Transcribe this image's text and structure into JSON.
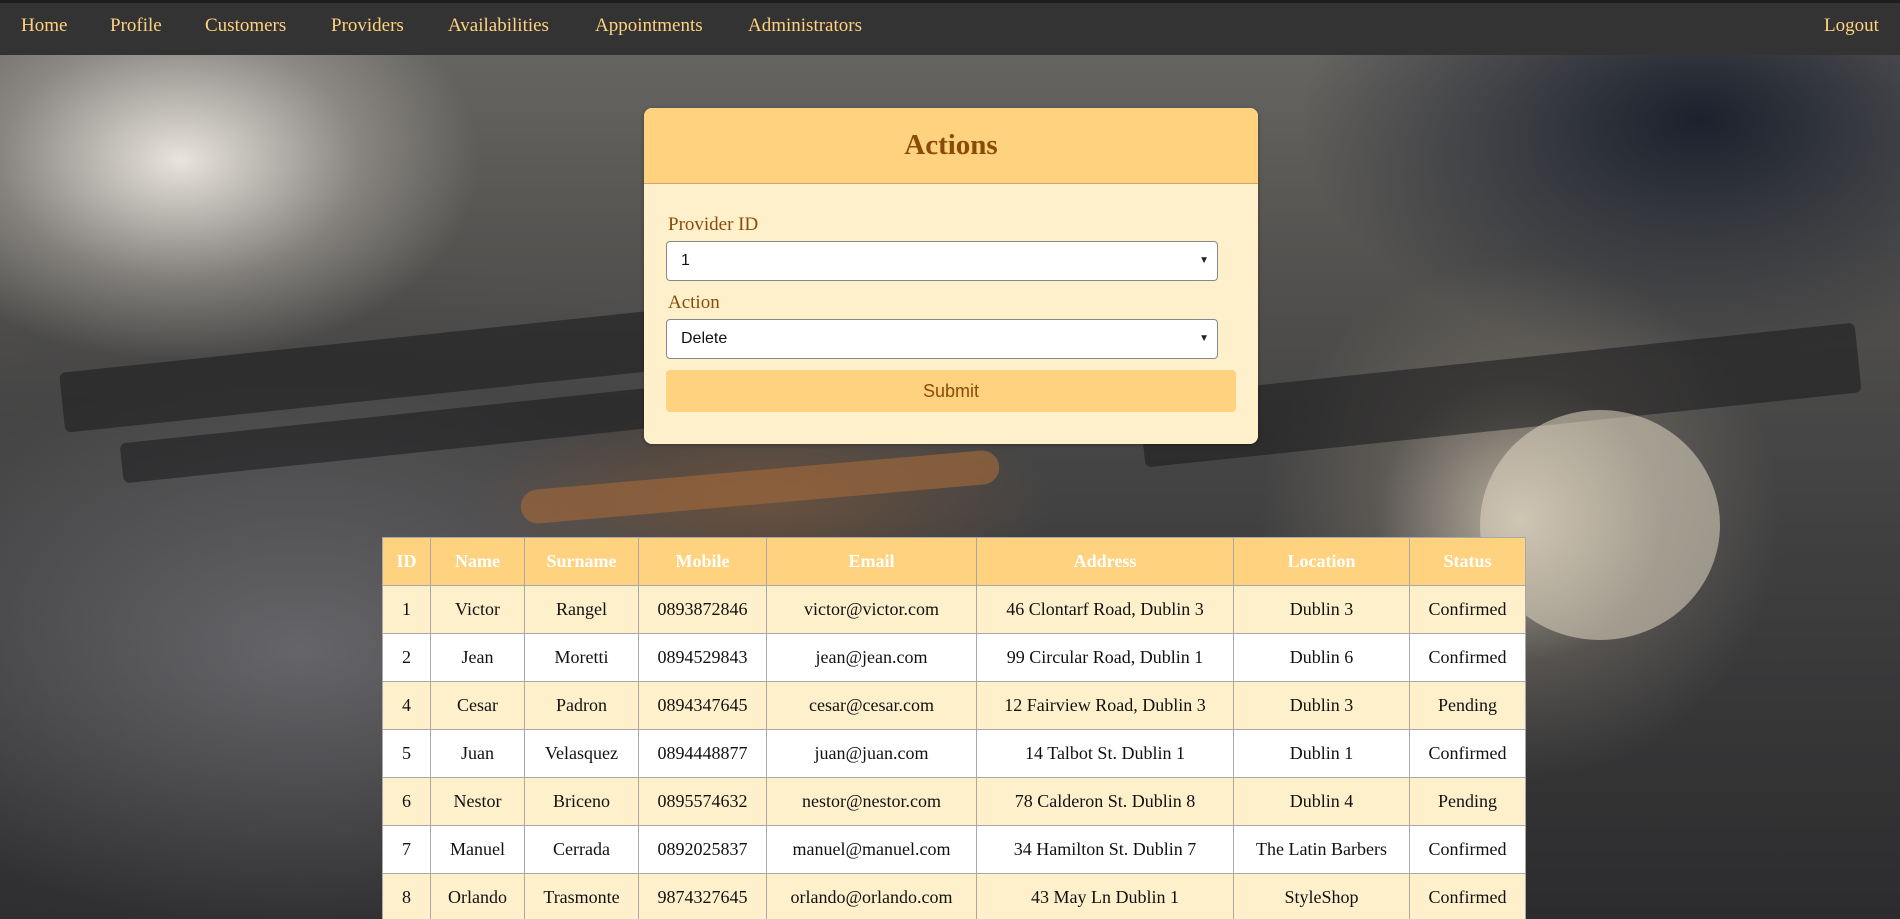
{
  "nav": {
    "items": [
      {
        "label": "Home"
      },
      {
        "label": "Profile"
      },
      {
        "label": "Customers"
      },
      {
        "label": "Providers"
      },
      {
        "label": "Availabilities"
      },
      {
        "label": "Appointments"
      },
      {
        "label": "Administrators"
      }
    ],
    "logout": "Logout"
  },
  "actions": {
    "title": "Actions",
    "provider_id_label": "Provider ID",
    "provider_id_value": "1",
    "action_label": "Action",
    "action_value": "Delete",
    "submit_label": "Submit"
  },
  "table": {
    "headers": [
      "ID",
      "Name",
      "Surname",
      "Mobile",
      "Email",
      "Address",
      "Location",
      "Status"
    ],
    "rows": [
      [
        "1",
        "Victor",
        "Rangel",
        "0893872846",
        "victor@victor.com",
        "46 Clontarf Road, Dublin 3",
        "Dublin 3",
        "Confirmed"
      ],
      [
        "2",
        "Jean",
        "Moretti",
        "0894529843",
        "jean@jean.com",
        "99 Circular Road, Dublin 1",
        "Dublin 6",
        "Confirmed"
      ],
      [
        "4",
        "Cesar",
        "Padron",
        "0894347645",
        "cesar@cesar.com",
        "12 Fairview Road, Dublin 3",
        "Dublin 3",
        "Pending"
      ],
      [
        "5",
        "Juan",
        "Velasquez",
        "0894448877",
        "juan@juan.com",
        "14 Talbot St. Dublin 1",
        "Dublin 1",
        "Confirmed"
      ],
      [
        "6",
        "Nestor",
        "Briceno",
        "0895574632",
        "nestor@nestor.com",
        "78 Calderon St. Dublin 8",
        "Dublin 4",
        "Pending"
      ],
      [
        "7",
        "Manuel",
        "Cerrada",
        "0892025837",
        "manuel@manuel.com",
        "34 Hamilton St. Dublin 7",
        "The Latin Barbers",
        "Confirmed"
      ],
      [
        "8",
        "Orlando",
        "Trasmonte",
        "9874327645",
        "orlando@orlando.com",
        "43 May Ln Dublin 1",
        "StyleShop",
        "Confirmed"
      ]
    ]
  },
  "icons": {
    "select_caret": "caret-down-icon"
  },
  "colors": {
    "accent": "#ffd27f",
    "card_bg": "#fff0cc",
    "title_text": "#8a4b08",
    "navbar_bg": "#333333"
  }
}
